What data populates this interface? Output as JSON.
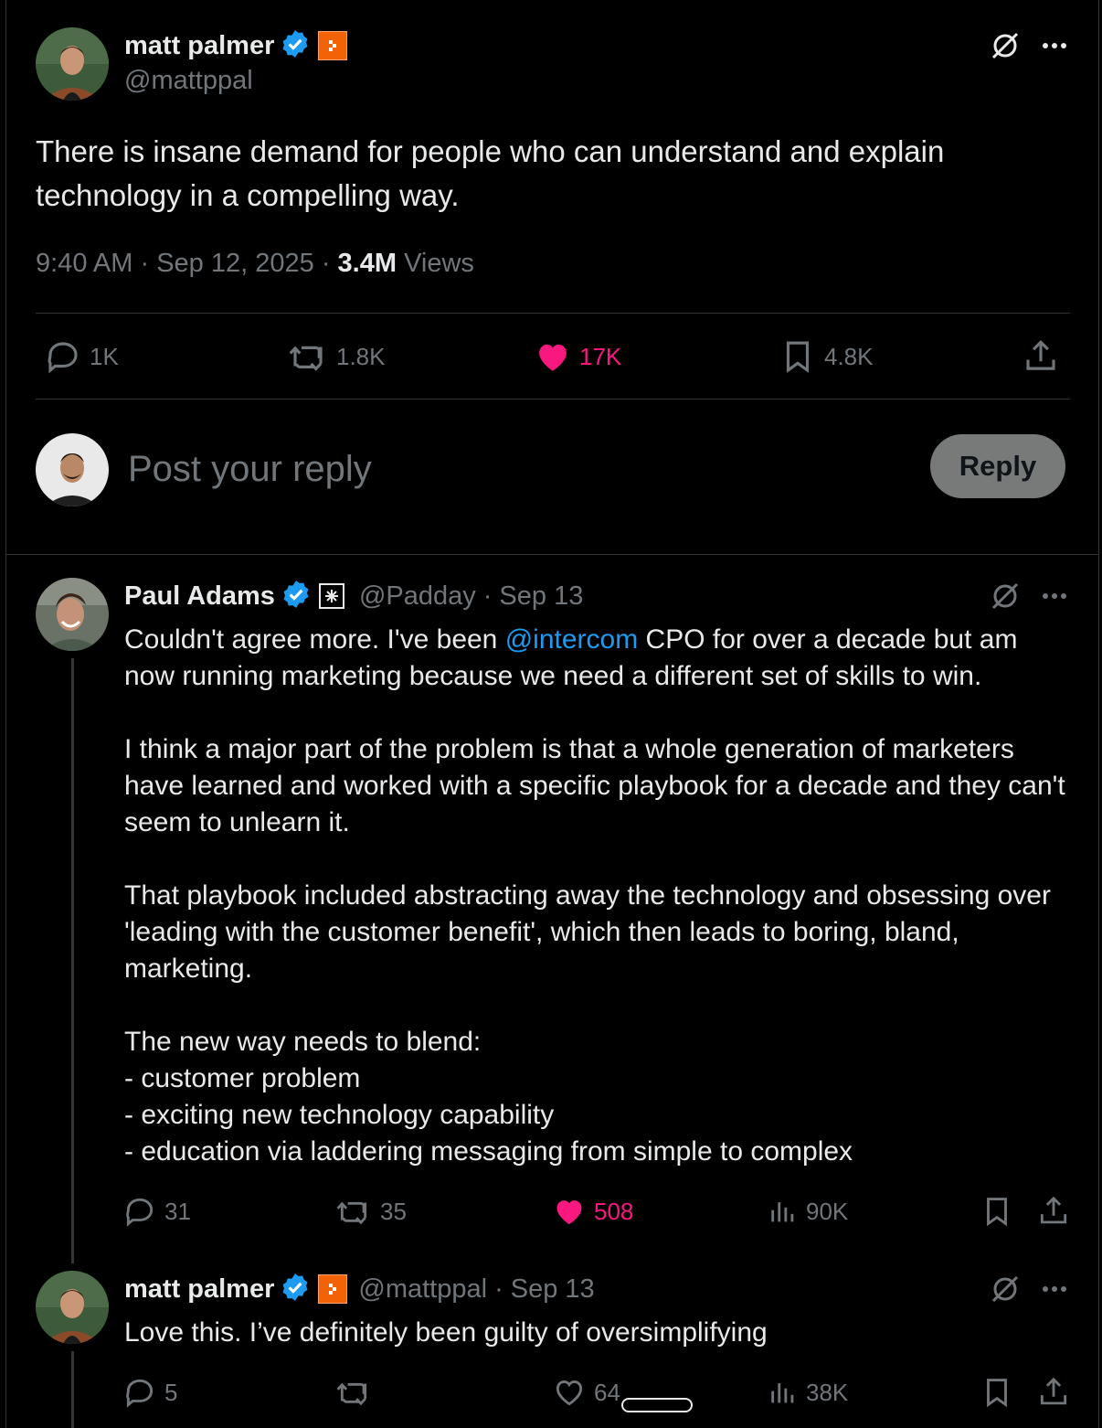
{
  "main_post": {
    "author_name": "matt palmer",
    "author_handle": "@mattppal",
    "text": "There is insane demand for people who can understand and explain technology in a compelling way.",
    "time": "9:40 AM",
    "date": "Sep 12, 2025",
    "views_count": "3.4M",
    "views_label": "Views",
    "replies": "1K",
    "reposts": "1.8K",
    "likes": "17K",
    "bookmarks": "4.8K"
  },
  "composer": {
    "placeholder": "Post your reply",
    "reply_button": "Reply"
  },
  "replies": [
    {
      "author_name": "Paul Adams",
      "author_handle": "@Padday",
      "date": "Sep 13",
      "text_pre": "Couldn't agree more. I've been ",
      "mention": "@intercom",
      "text_post": " CPO for over a decade but am now running marketing because we need a different set of skills to win.\n\nI think a major part of the problem is that a whole generation of marketers have learned and worked with a specific playbook for a decade and they can't seem to unlearn it.\n\nThat playbook included abstracting away the technology and obsessing over 'leading with the customer benefit', which then leads to boring, bland, marketing.\n\nThe new way needs to blend:\n- customer problem\n- exciting new technology capability\n- education via laddering messaging from simple to complex",
      "replies": "31",
      "reposts": "35",
      "likes": "508",
      "views": "90K"
    },
    {
      "author_name": "matt palmer",
      "author_handle": "@mattppal",
      "date": "Sep 13",
      "text": "Love this. I’ve definitely been guilty of oversimplifying",
      "replies": "5",
      "likes": "64",
      "views": "38K"
    }
  ],
  "separator": "·",
  "colors": {
    "background": "#000000",
    "text": "#e7e9ea",
    "muted": "#71767b",
    "like_pink": "#f91880",
    "link_blue": "#1d9bf0",
    "verified_blue": "#1d9bf0",
    "badge_orange": "#f26207"
  }
}
